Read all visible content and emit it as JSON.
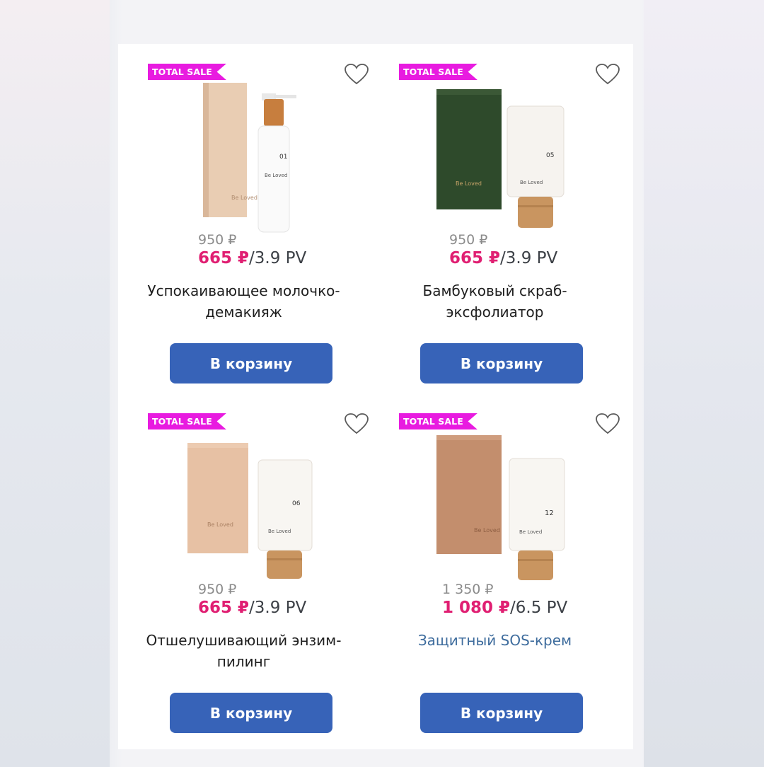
{
  "products": [
    {
      "badge": "TOTAL SALE",
      "old_price": "950 ₽",
      "new_price": "665 ₽",
      "pv": "/3.9 PV",
      "title": "Успокаивающее молочко-демакияж",
      "button": "В корзину",
      "box_color": "#e8c9ad",
      "box_text": "Be Loved",
      "pack": "bottle",
      "pack_number": "01",
      "pack_text": "Be Loved"
    },
    {
      "badge": "TOTAL SALE",
      "old_price": "950 ₽",
      "new_price": "665 ₽",
      "pv": "/3.9 PV",
      "title": "Бамбуковый скраб-эксфолиатор",
      "button": "В корзину",
      "box_color": "#2d4a2a",
      "box_text": "Be Loved",
      "pack": "tube",
      "pack_number": "05",
      "pack_text": "Be Loved"
    },
    {
      "badge": "TOTAL SALE",
      "old_price": "950 ₽",
      "new_price": "665 ₽",
      "pv": "/3.9 PV",
      "title": "Отшелушивающий энзим-пилинг",
      "button": "В корзину",
      "box_color": "#e6bd9f",
      "box_text": "Be Loved",
      "pack": "tube",
      "pack_number": "06",
      "pack_text": "Be Loved"
    },
    {
      "badge": "TOTAL SALE",
      "old_price": "1 350 ₽",
      "new_price": "1 080 ₽",
      "pv": "/6.5 PV",
      "title": "Защитный SOS-крем",
      "button": "В корзину",
      "box_color": "#c28d6c",
      "box_text": "Be Loved",
      "pack": "tube",
      "pack_number": "12",
      "pack_text": "Be Loved"
    }
  ],
  "colors": {
    "badge": "#e81be0",
    "new_price": "#e01f72",
    "button": "#3763b8",
    "title_link": "#3e6c9d"
  }
}
